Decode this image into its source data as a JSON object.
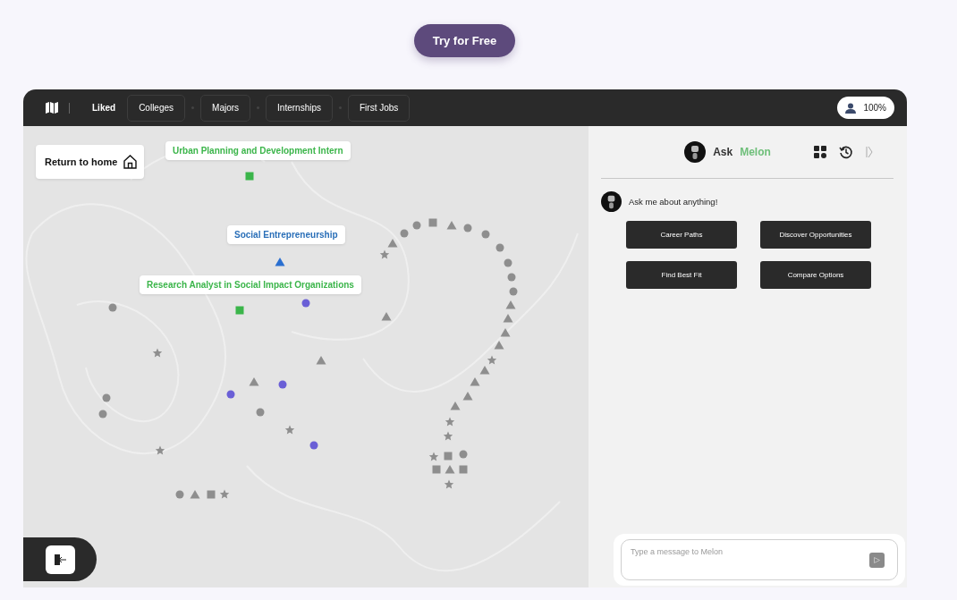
{
  "cta": {
    "label": "Try for Free"
  },
  "nav": {
    "tabs": [
      {
        "label": "Liked",
        "selected": true
      },
      {
        "label": "Colleges",
        "selected": false
      },
      {
        "label": "Majors",
        "selected": false
      },
      {
        "label": "Internships",
        "selected": false
      },
      {
        "label": "First Jobs",
        "selected": false
      }
    ],
    "profile": {
      "label": "100%"
    }
  },
  "map": {
    "home_button": {
      "label": "Return to home"
    },
    "labels": [
      {
        "text": "Urban Planning and Development Intern",
        "color": "#3bb54a"
      },
      {
        "text": "Social Entrepreneurship",
        "color": "#2a6fb8"
      },
      {
        "text": "Research Analyst in Social Impact Organizations",
        "color": "#3bb54a"
      }
    ],
    "markers": [
      {
        "kind": "circle",
        "color": "#8e8e8e"
      },
      {
        "kind": "circle",
        "color": "#8e8e8e"
      },
      {
        "kind": "square",
        "color": "#8e8e8e"
      },
      {
        "kind": "triangle",
        "color": "#8e8e8e"
      },
      {
        "kind": "circle",
        "color": "#8e8e8e"
      },
      {
        "kind": "circle",
        "color": "#8e8e8e"
      },
      {
        "kind": "circle",
        "color": "#8e8e8e"
      },
      {
        "kind": "circle",
        "color": "#8e8e8e"
      },
      {
        "kind": "circle",
        "color": "#8e8e8e"
      },
      {
        "kind": "circle",
        "color": "#8e8e8e"
      },
      {
        "kind": "triangle",
        "color": "#8e8e8e"
      },
      {
        "kind": "triangle",
        "color": "#8e8e8e"
      },
      {
        "kind": "triangle",
        "color": "#8e8e8e"
      },
      {
        "kind": "triangle",
        "color": "#8e8e8e"
      },
      {
        "kind": "star",
        "color": "#8e8e8e"
      },
      {
        "kind": "triangle",
        "color": "#8e8e8e"
      },
      {
        "kind": "triangle",
        "color": "#8e8e8e"
      },
      {
        "kind": "triangle",
        "color": "#8e8e8e"
      },
      {
        "kind": "triangle",
        "color": "#8e8e8e"
      },
      {
        "kind": "star",
        "color": "#8e8e8e"
      },
      {
        "kind": "star",
        "color": "#8e8e8e"
      },
      {
        "kind": "star",
        "color": "#8e8e8e"
      },
      {
        "kind": "square",
        "color": "#8e8e8e"
      },
      {
        "kind": "circle",
        "color": "#8e8e8e"
      },
      {
        "kind": "square",
        "color": "#8e8e8e"
      },
      {
        "kind": "triangle",
        "color": "#8e8e8e"
      },
      {
        "kind": "square",
        "color": "#8e8e8e"
      },
      {
        "kind": "star",
        "color": "#8e8e8e"
      },
      {
        "kind": "triangle",
        "color": "#8e8e8e"
      },
      {
        "kind": "star",
        "color": "#8e8e8e"
      },
      {
        "kind": "triangle",
        "color": "#8e8e8e"
      },
      {
        "kind": "circle",
        "color": "#8e8e8e"
      },
      {
        "kind": "star",
        "color": "#8e8e8e"
      },
      {
        "kind": "triangle",
        "color": "#8e8e8e"
      },
      {
        "kind": "triangle",
        "color": "#8e8e8e"
      },
      {
        "kind": "circle",
        "color": "#6a5fd6"
      },
      {
        "kind": "circle",
        "color": "#6a5fd6"
      },
      {
        "kind": "circle",
        "color": "#8e8e8e"
      },
      {
        "kind": "circle",
        "color": "#8e8e8e"
      },
      {
        "kind": "circle",
        "color": "#8e8e8e"
      },
      {
        "kind": "star",
        "color": "#8e8e8e"
      },
      {
        "kind": "circle",
        "color": "#6a5fd6"
      },
      {
        "kind": "star",
        "color": "#8e8e8e"
      },
      {
        "kind": "circle",
        "color": "#8e8e8e"
      },
      {
        "kind": "triangle",
        "color": "#8e8e8e"
      },
      {
        "kind": "square",
        "color": "#8e8e8e"
      },
      {
        "kind": "star",
        "color": "#8e8e8e"
      },
      {
        "kind": "circle",
        "color": "#6a5fd6"
      },
      {
        "kind": "square",
        "color": "#3bb54a"
      },
      {
        "kind": "square",
        "color": "#3bb54a"
      },
      {
        "kind": "triangle",
        "color": "#2a6fd0"
      }
    ]
  },
  "chat": {
    "title": "Ask",
    "title_accent": "Melon",
    "message": "Ask me about anything!",
    "suggestions": [
      "Career Paths",
      "Discover Opportunities",
      "Find Best Fit",
      "Compare Options"
    ],
    "input": {
      "placeholder": "Type a message to Melon"
    }
  }
}
